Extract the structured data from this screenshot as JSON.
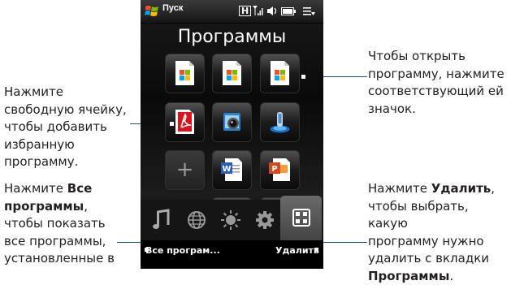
{
  "status_bar": {
    "start_label": "Пуск",
    "icons": [
      "windows-logo",
      "h-icon",
      "signal-icon",
      "volume-icon",
      "battery-icon",
      "menu-icon"
    ]
  },
  "screen_title": "Программы",
  "tiles": [
    {
      "name": "program-tile-1",
      "icon": "doc-windows-icon"
    },
    {
      "name": "program-tile-2",
      "icon": "doc-windows-icon"
    },
    {
      "name": "program-tile-3",
      "icon": "doc-windows-icon"
    },
    {
      "name": "program-tile-4",
      "icon": "adobe-reader-icon"
    },
    {
      "name": "program-tile-5",
      "icon": "camera-icon"
    },
    {
      "name": "program-tile-6",
      "icon": "satellite-icon"
    },
    {
      "name": "add-favorite-tile",
      "icon": "plus-icon",
      "label": "+"
    },
    {
      "name": "program-tile-8",
      "icon": "word-icon"
    },
    {
      "name": "program-tile-9",
      "icon": "powerpoint-icon"
    }
  ],
  "tabs": [
    "music-icon",
    "internet-icon",
    "weather-icon",
    "settings-icon",
    "programs-icon"
  ],
  "softkeys": {
    "left": "Все програм...",
    "right": "Удалить"
  },
  "callouts": {
    "left_top": [
      "Нажмите",
      "свободную ячейку,",
      "чтобы добавить",
      "избранную",
      "программу."
    ],
    "left_bottom": {
      "line1_pre": "Нажмите ",
      "line1_bold": "Все",
      "line2_bold": "программы",
      "line2_post": ",",
      "rest": [
        "чтобы показать",
        "все программы,",
        "установленные в"
      ]
    },
    "right_top": [
      "Чтобы открыть",
      "программу, нажмите",
      "соответствующий ей",
      "значок."
    ],
    "right_bottom": {
      "line1_pre": "Нажмите ",
      "line1_bold": "Удалить",
      "line1_post": ",",
      "rest": [
        "чтобы выбрать, какую",
        "программу нужно",
        "удалить с вкладки"
      ],
      "last_bold": "Программы",
      "last_post": "."
    }
  },
  "colors": {
    "leader_line": "#1b4e8c"
  }
}
